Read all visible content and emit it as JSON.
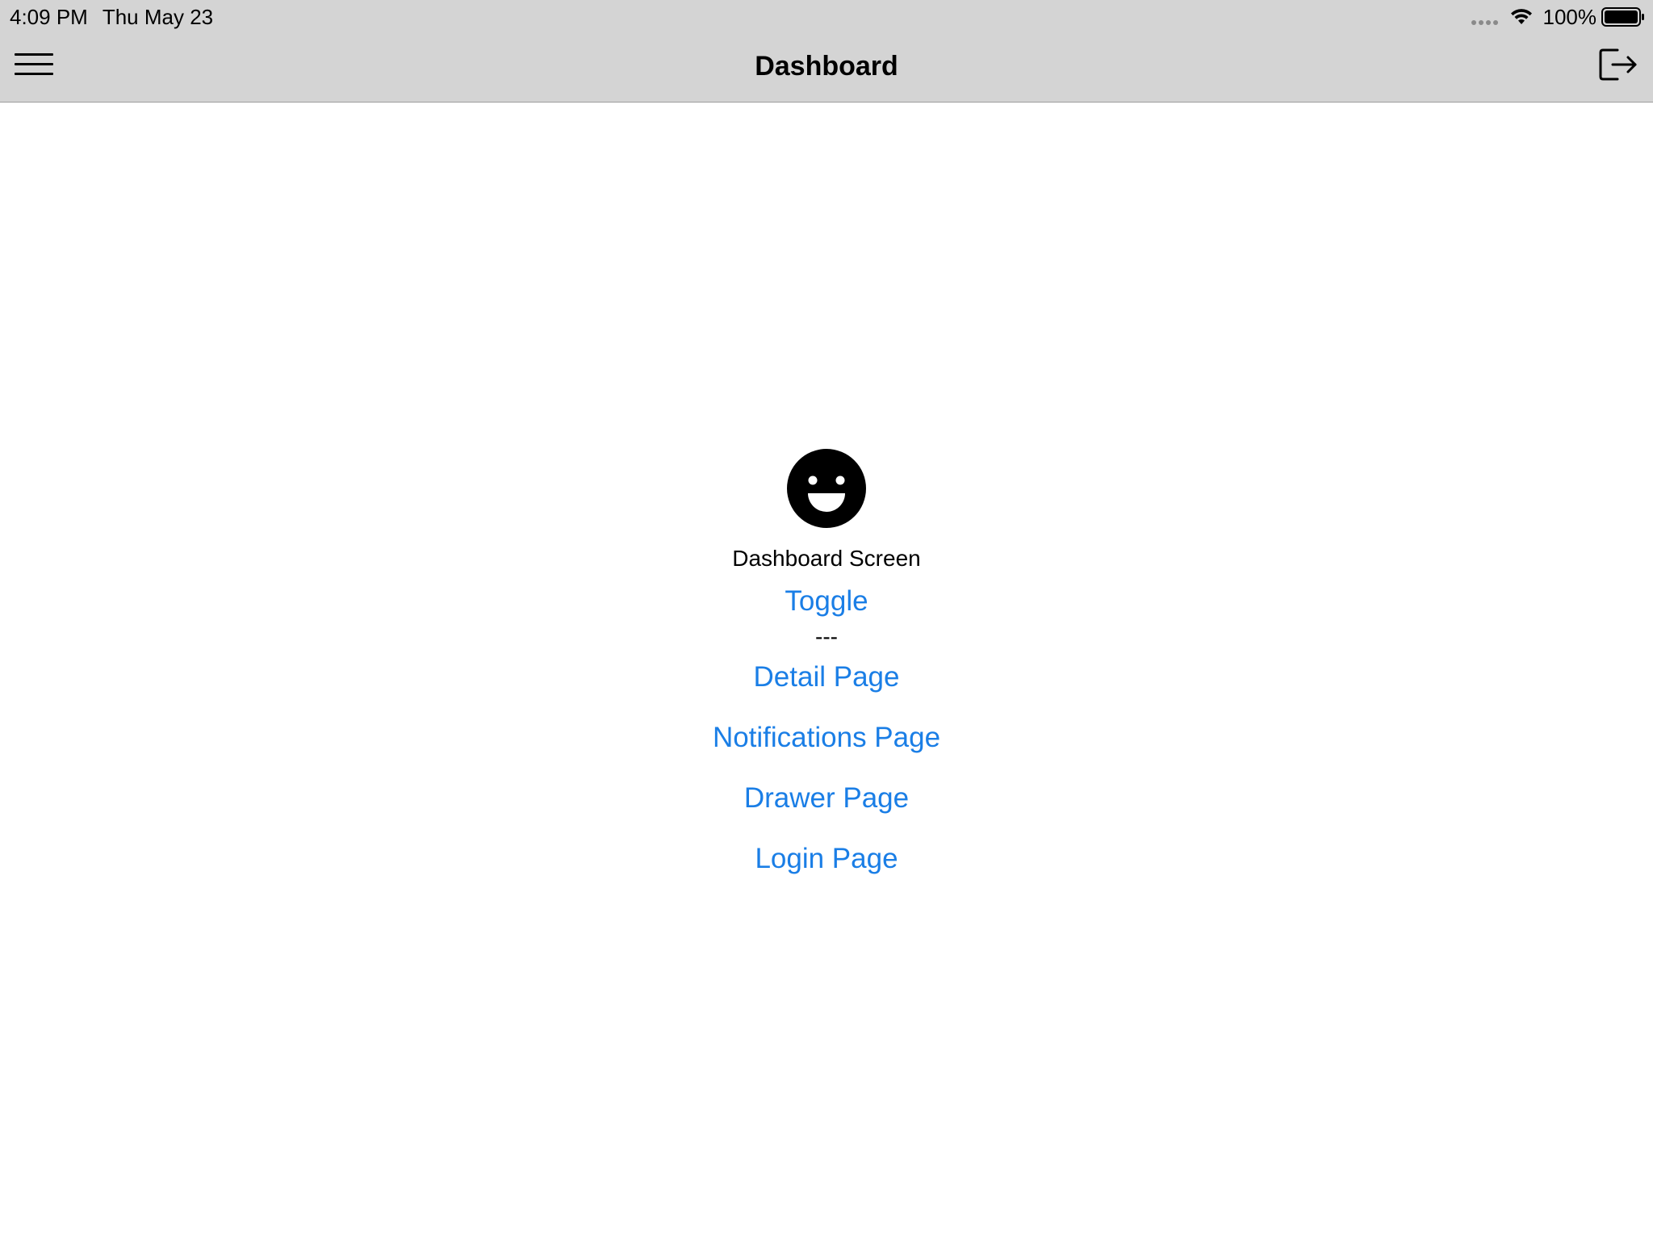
{
  "status_bar": {
    "time": "4:09 PM",
    "date": "Thu May 23",
    "battery_percent": "100%",
    "battery_level": 1.0,
    "icons": [
      "signal-dots-icon",
      "wifi-icon",
      "battery-icon"
    ]
  },
  "nav_bar": {
    "title": "Dashboard",
    "left_icon": "menu-icon",
    "right_icon": "logout-icon"
  },
  "main": {
    "icon": "smiley-face-icon",
    "screen_label": "Dashboard Screen",
    "toggle_label": "Toggle",
    "separator": "---",
    "links": [
      {
        "label": "Detail Page"
      },
      {
        "label": "Notifications Page"
      },
      {
        "label": "Drawer Page"
      },
      {
        "label": "Login Page"
      }
    ]
  },
  "colors": {
    "nav_background": "#d4d4d4",
    "link": "#1a7ee6",
    "text": "#000000",
    "background": "#ffffff"
  }
}
